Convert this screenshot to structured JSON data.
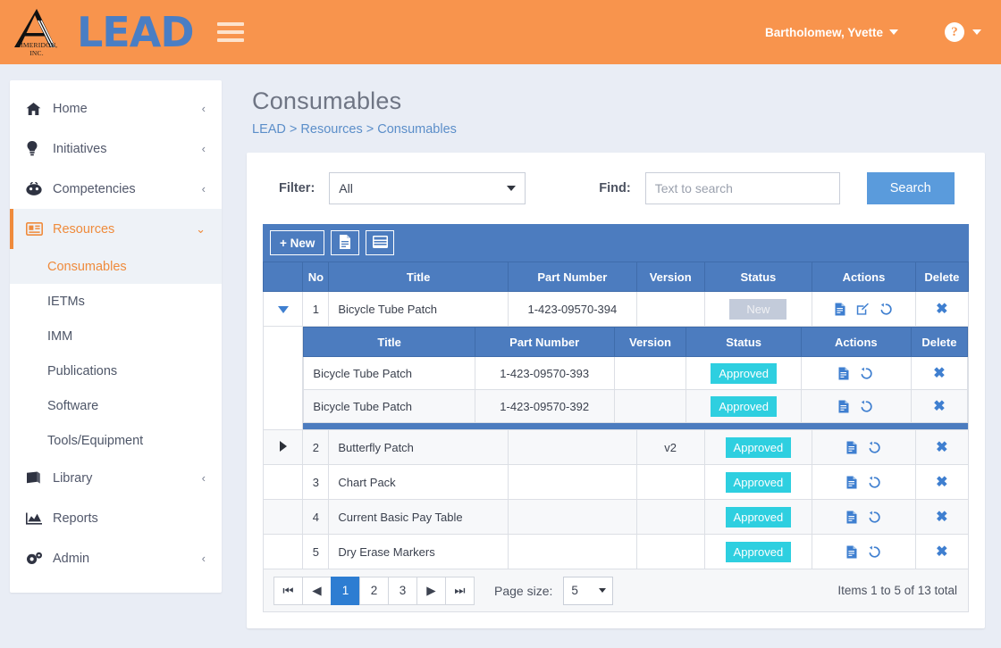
{
  "header": {
    "logo_caption": "AIMERIDON, INC.",
    "brand_word": "LEAD",
    "menu_icon": "hamburger-icon",
    "user_name": "Bartholomew, Yvette",
    "help_glyph": "?"
  },
  "sidebar": {
    "items": [
      {
        "label": "Home",
        "icon": "home-icon",
        "chevron": "‹",
        "active": false
      },
      {
        "label": "Initiatives",
        "icon": "lightbulb-icon",
        "chevron": "‹",
        "active": false
      },
      {
        "label": "Competencies",
        "icon": "competency-icon",
        "chevron": "‹",
        "active": false
      },
      {
        "label": "Resources",
        "icon": "resources-icon",
        "chevron": "⌄",
        "active": true
      }
    ],
    "sub_items": [
      {
        "label": "Consumables",
        "selected": true
      },
      {
        "label": "IETMs",
        "selected": false
      },
      {
        "label": "IMM",
        "selected": false
      },
      {
        "label": "Publications",
        "selected": false
      },
      {
        "label": "Software",
        "selected": false
      },
      {
        "label": "Tools/Equipment",
        "selected": false
      }
    ],
    "tail_items": [
      {
        "label": "Library",
        "icon": "book-icon",
        "chevron": "‹"
      },
      {
        "label": "Reports",
        "icon": "chart-icon",
        "chevron": ""
      },
      {
        "label": "Admin",
        "icon": "gears-icon",
        "chevron": "‹"
      }
    ]
  },
  "main": {
    "page_title": "Consumables",
    "breadcrumb": "LEAD > Resources > Consumables"
  },
  "filter": {
    "filter_label": "Filter:",
    "filter_value": "All",
    "find_label": "Find:",
    "find_value": "",
    "find_placeholder": "Text to search",
    "search_label": "Search"
  },
  "toolbar": {
    "new_label": "+ New",
    "export_icon": "document-icon",
    "columns_icon": "table-icon"
  },
  "grid": {
    "columns": [
      "",
      "No",
      "Title",
      "Part Number",
      "Version",
      "Status",
      "Actions",
      "Delete"
    ],
    "sub_columns": [
      "Title",
      "Part Number",
      "Version",
      "Status",
      "Actions",
      "Delete"
    ],
    "rows": [
      {
        "expander": "expanded",
        "no": "1",
        "title": "Bicycle Tube Patch",
        "part_number": "1-423-09570-394",
        "version": "",
        "status": "New",
        "status_kind": "new",
        "actions": [
          "document-icon",
          "edit-icon",
          "history-icon"
        ],
        "delete": "✖",
        "children": [
          {
            "title": "Bicycle Tube Patch",
            "part_number": "1-423-09570-393",
            "version": "",
            "status": "Approved",
            "status_kind": "approved",
            "actions": [
              "document-icon",
              "history-icon"
            ],
            "delete": "✖"
          },
          {
            "title": "Bicycle Tube Patch",
            "part_number": "1-423-09570-392",
            "version": "",
            "status": "Approved",
            "status_kind": "approved",
            "actions": [
              "document-icon",
              "history-icon"
            ],
            "delete": "✖"
          }
        ]
      },
      {
        "expander": "collapsed",
        "no": "2",
        "title": "Butterfly Patch",
        "part_number": "",
        "version": "v2",
        "status": "Approved",
        "status_kind": "approved",
        "actions": [
          "document-icon",
          "history-icon"
        ],
        "delete": "✖",
        "children": []
      },
      {
        "expander": "none",
        "no": "3",
        "title": "Chart Pack",
        "part_number": "",
        "version": "",
        "status": "Approved",
        "status_kind": "approved",
        "actions": [
          "document-icon",
          "history-icon"
        ],
        "delete": "✖",
        "children": []
      },
      {
        "expander": "none",
        "no": "4",
        "title": "Current Basic Pay Table",
        "part_number": "",
        "version": "",
        "status": "Approved",
        "status_kind": "approved",
        "actions": [
          "document-icon",
          "history-icon"
        ],
        "delete": "✖",
        "children": []
      },
      {
        "expander": "none",
        "no": "5",
        "title": "Dry Erase Markers",
        "part_number": "",
        "version": "",
        "status": "Approved",
        "status_kind": "approved",
        "actions": [
          "document-icon",
          "history-icon"
        ],
        "delete": "✖",
        "children": []
      }
    ]
  },
  "pager": {
    "first": "⏮",
    "prev": "◀",
    "pages": [
      "1",
      "2",
      "3"
    ],
    "current_page": "1",
    "next": "▶",
    "last": "⏭",
    "page_size_label": "Page size:",
    "page_size_value": "5",
    "info": "Items 1 to 5 of 13 total"
  },
  "colors": {
    "header_orange": "#f8944d",
    "brand_blue": "#4a7ec4",
    "grid_blue": "#4c7cbf",
    "approved_teal": "#2ecfe0",
    "new_gray": "#c3cbda",
    "accent_orange": "#ef8b3c",
    "page_bg": "#e9edf5"
  }
}
